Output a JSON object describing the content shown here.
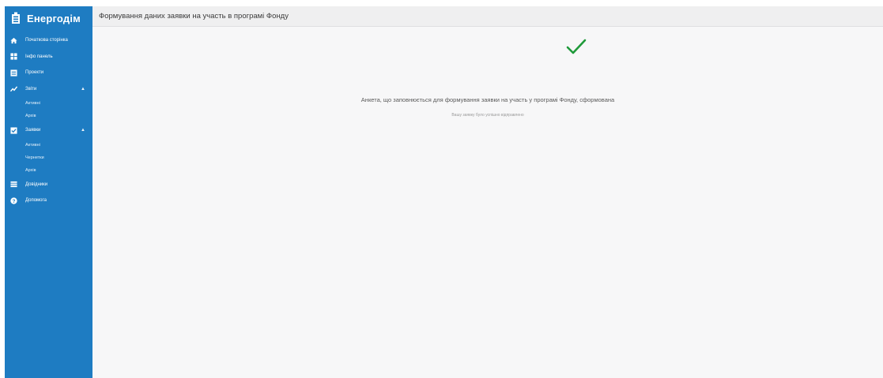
{
  "sidebar": {
    "brand": "Енергодім",
    "items": [
      {
        "label": "Початкова сторінка",
        "icon": "home-icon"
      },
      {
        "label": "Інфо панель",
        "icon": "dashboard-icon"
      },
      {
        "label": "Проекти",
        "icon": "projects-icon"
      },
      {
        "label": "Звіти",
        "icon": "chart-icon",
        "expanded": true,
        "children": [
          "Активні",
          "Архів"
        ]
      },
      {
        "label": "Заявки",
        "icon": "checklist-icon",
        "expanded": true,
        "children": [
          "Активні",
          "Чернетки",
          "Архів"
        ]
      },
      {
        "label": "Довідники",
        "icon": "list-icon"
      },
      {
        "label": "Допомога",
        "icon": "help-icon"
      }
    ]
  },
  "header": {
    "title": "Формування даних заявки на участь в програмі Фонду"
  },
  "main": {
    "success_icon": "checkmark-icon",
    "message": "Анкета, що заповнюється для формування заявки на участь у програмі Фонду, сформована",
    "submessage": "Вашу заявку було успішно відправлено"
  },
  "colors": {
    "sidebar": "#1e7cc2",
    "success": "#1f9a3a",
    "background": "#f7f7f8"
  }
}
